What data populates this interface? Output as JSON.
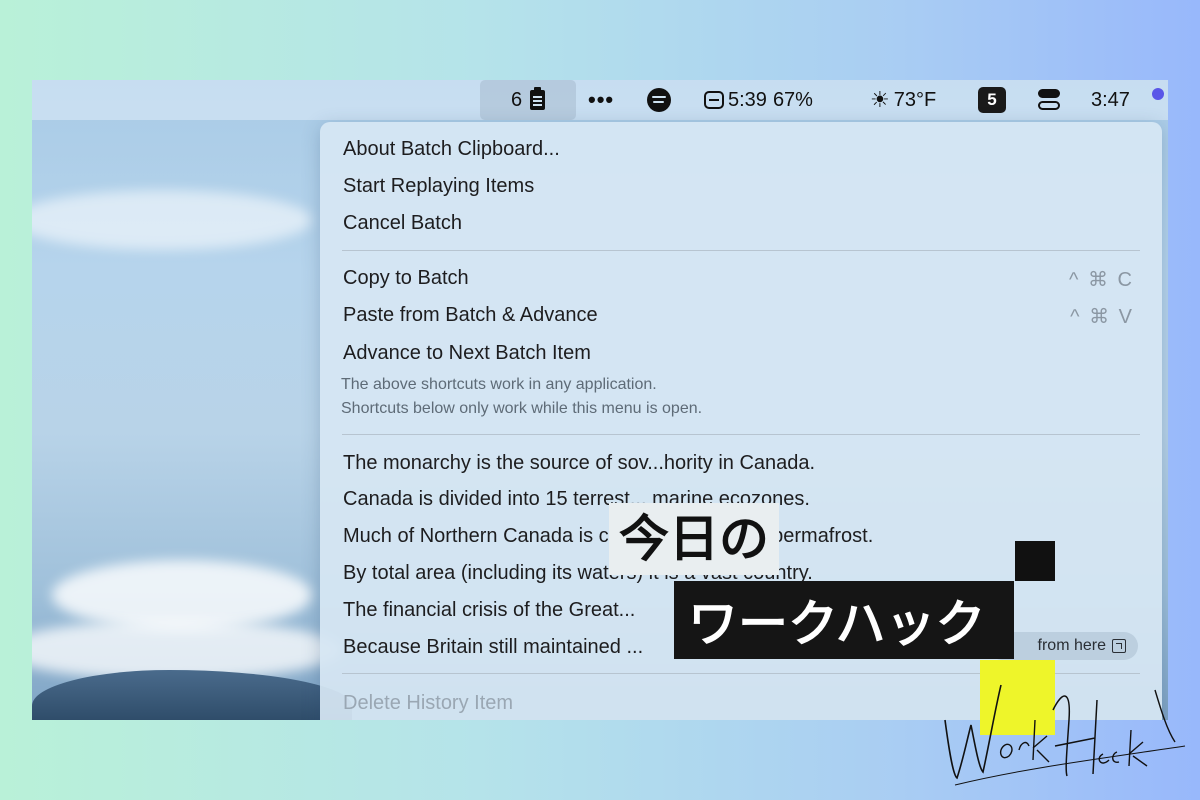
{
  "menubar": {
    "batch_count": "6",
    "overflow": "•••",
    "battery_time": "5:39",
    "battery_percent": "67%",
    "weather_temp": "73°F",
    "badge_number": "5",
    "clock": "3:47",
    "icons": [
      "clipboard-icon",
      "spotify-icon",
      "battery-icon",
      "sun-icon",
      "control-center-icon"
    ]
  },
  "menu": {
    "about": "About Batch Clipboard...",
    "start_replaying": "Start Replaying Items",
    "cancel_batch": "Cancel Batch",
    "copy_to_batch": "Copy to Batch",
    "copy_shortcut": "^ ⌘ C",
    "paste_from_batch": "Paste from Batch & Advance",
    "paste_shortcut": "^ ⌘ V",
    "advance_next": "Advance to Next Batch Item",
    "note_1": "The above shortcuts work in any application.",
    "note_2": "Shortcuts below only work while this menu is open.",
    "history": [
      "The monarchy is the source of sov...hority in Canada.",
      "Canada is divided into 15 terrest... marine ecozones.",
      "Much of Northern Canada is covered by ice and permafrost.",
      "By total area (including its waters) it is a vast country.",
      "The financial crisis of the Great...",
      "Because Britain still maintained ..."
    ],
    "start_here_label": "from here",
    "delete_history": "Delete History Item"
  },
  "overlay": {
    "title_line1": "今日の",
    "title_line2": "ワークハック",
    "signature": "Work Hack"
  }
}
